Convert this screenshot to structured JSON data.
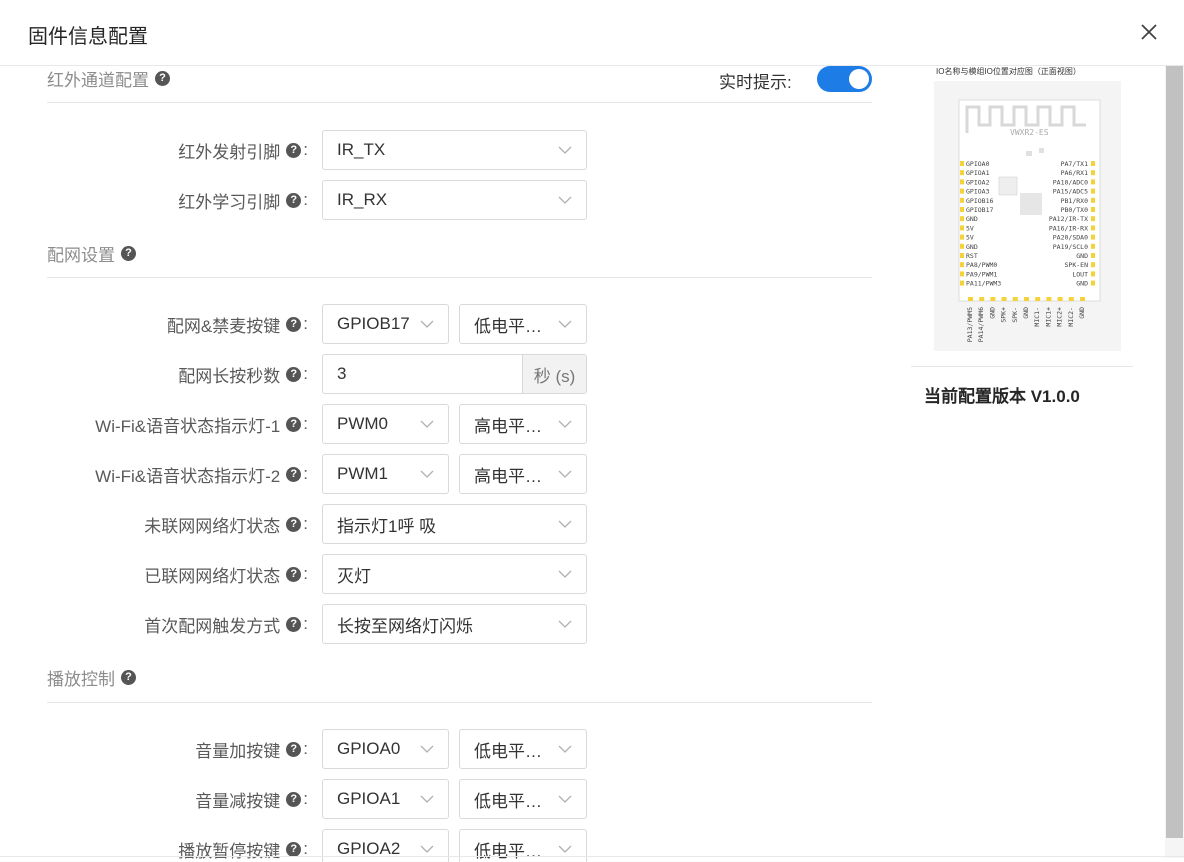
{
  "dialog": {
    "title": "固件信息配置"
  },
  "help_glyph": "?",
  "colon": ":",
  "sections": {
    "ir": {
      "title": "红外通道配置",
      "realtime_label": "实时提示:",
      "realtime_on": true
    },
    "net": {
      "title": "配网设置"
    },
    "play": {
      "title": "播放控制"
    }
  },
  "fields": {
    "ir_tx": {
      "label": "红外发射引脚",
      "value": "IR_TX"
    },
    "ir_rx": {
      "label": "红外学习引脚",
      "value": "IR_RX"
    },
    "net_key": {
      "label": "配网&禁麦按键",
      "value": "GPIOB17",
      "level": "低电平…"
    },
    "net_secs": {
      "label": "配网长按秒数",
      "value": "3",
      "unit": "秒 (s)"
    },
    "led1": {
      "label": "Wi-Fi&语音状态指示灯-1",
      "value": "PWM0",
      "level": "高电平…"
    },
    "led2": {
      "label": "Wi-Fi&语音状态指示灯-2",
      "value": "PWM1",
      "level": "高电平…"
    },
    "offline_led": {
      "label": "未联网网络灯状态",
      "value": "指示灯1呼 吸"
    },
    "online_led": {
      "label": "已联网网络灯状态",
      "value": "灭灯"
    },
    "first_trigger": {
      "label": "首次配网触发方式",
      "value": "长按至网络灯闪烁"
    },
    "vol_up": {
      "label": "音量加按键",
      "value": "GPIOA0",
      "level": "低电平…"
    },
    "vol_down": {
      "label": "音量减按键",
      "value": "GPIOA1",
      "level": "低电平…"
    },
    "play_pause": {
      "label": "播放暂停按键",
      "value": "GPIOA2",
      "level": "低电平…"
    }
  },
  "pinout": {
    "caption": "IO名称与模组IO位置对应图（正面视图）",
    "module_name": "VWXR2-ES",
    "left_pins": [
      "GPIOA0",
      "GPIOA1",
      "GPIOA2",
      "GPIOA3",
      "GPIOB16",
      "GPIOB17",
      "GND",
      "5V",
      "5V",
      "GND",
      "RST",
      "PA8/PWM0",
      "PA9/PWM1",
      "PA11/PWM3"
    ],
    "right_pins": [
      "PA7/TX1",
      "PA6/RX1",
      "PA10/ADC0",
      "PA15/ADC5",
      "PB1/RX0",
      "PB0/TX0",
      "PA12/IR-TX",
      "PA16/IR-RX",
      "PA20/SDA0",
      "PA19/SCL0",
      "GND",
      "SPK-EN",
      "LOUT",
      "GND"
    ],
    "bottom_pins": [
      "PA13/PWM5",
      "PA14/PWM6",
      "GND",
      "SPK+",
      "SPK-",
      "GND",
      "MIC1-",
      "MIC1+",
      "MIC2+",
      "MIC2-",
      "GND"
    ]
  },
  "version": {
    "label": "当前配置版本 V1.0.0"
  }
}
